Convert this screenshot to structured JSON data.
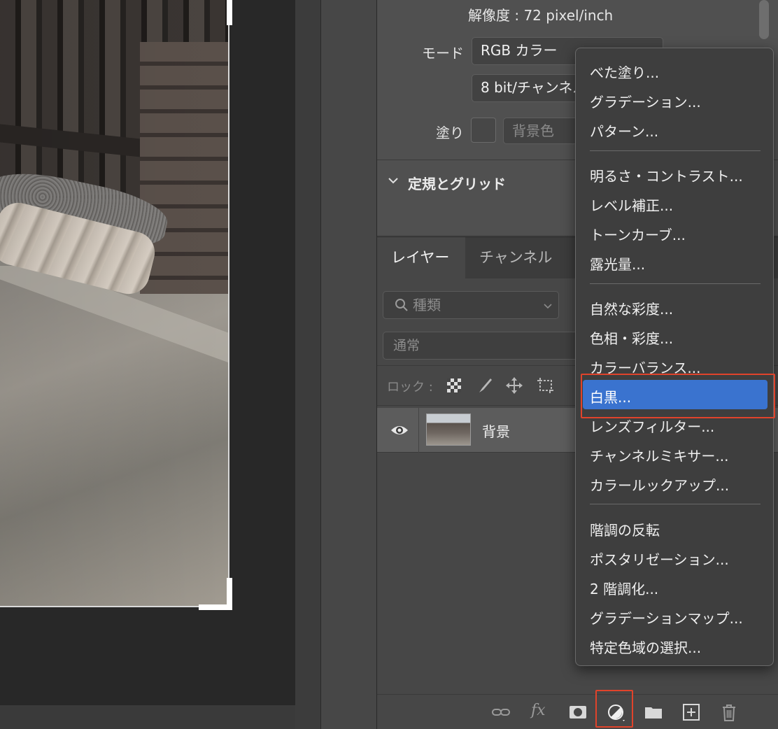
{
  "properties": {
    "resolution": "解像度 : 72 pixel/inch",
    "mode_label": "モード",
    "mode_value": "RGB カラー",
    "bitdepth_value": "8 bit/チャンネル",
    "fill_label": "塗り",
    "fill_value": "背景色",
    "rulers_section_title": "定規とグリッド"
  },
  "layers_panel": {
    "tabs": [
      {
        "label": "レイヤー",
        "active": true
      },
      {
        "label": "チャンネル",
        "active": false
      }
    ],
    "filter_placeholder": "種類",
    "blend_mode": "通常",
    "lock_label": "ロック :",
    "layers": [
      {
        "name": "背景",
        "visible": true
      }
    ]
  },
  "adjustment_menu": {
    "groups": [
      [
        "べた塗り...",
        "グラデーション...",
        "パターン..."
      ],
      [
        "明るさ・コントラスト...",
        "レベル補正...",
        "トーンカーブ...",
        "露光量..."
      ],
      [
        "自然な彩度...",
        "色相・彩度...",
        "カラーバランス...",
        "白黒...",
        "レンズフィルター...",
        "チャンネルミキサー...",
        "カラールックアップ..."
      ],
      [
        "階調の反転",
        "ポスタリゼーション...",
        "2 階調化...",
        "グラデーションマップ...",
        "特定色域の選択..."
      ]
    ],
    "selected": "白黒...",
    "highlight_color": "#3a73cf",
    "annotation_color": "#e0432b"
  },
  "bottom_bar_icons": [
    "link-icon",
    "fx-icon",
    "mask-icon",
    "adjustment-layer-icon",
    "folder-icon",
    "new-layer-icon",
    "trash-icon"
  ],
  "bottom_bar_fx": "fx"
}
